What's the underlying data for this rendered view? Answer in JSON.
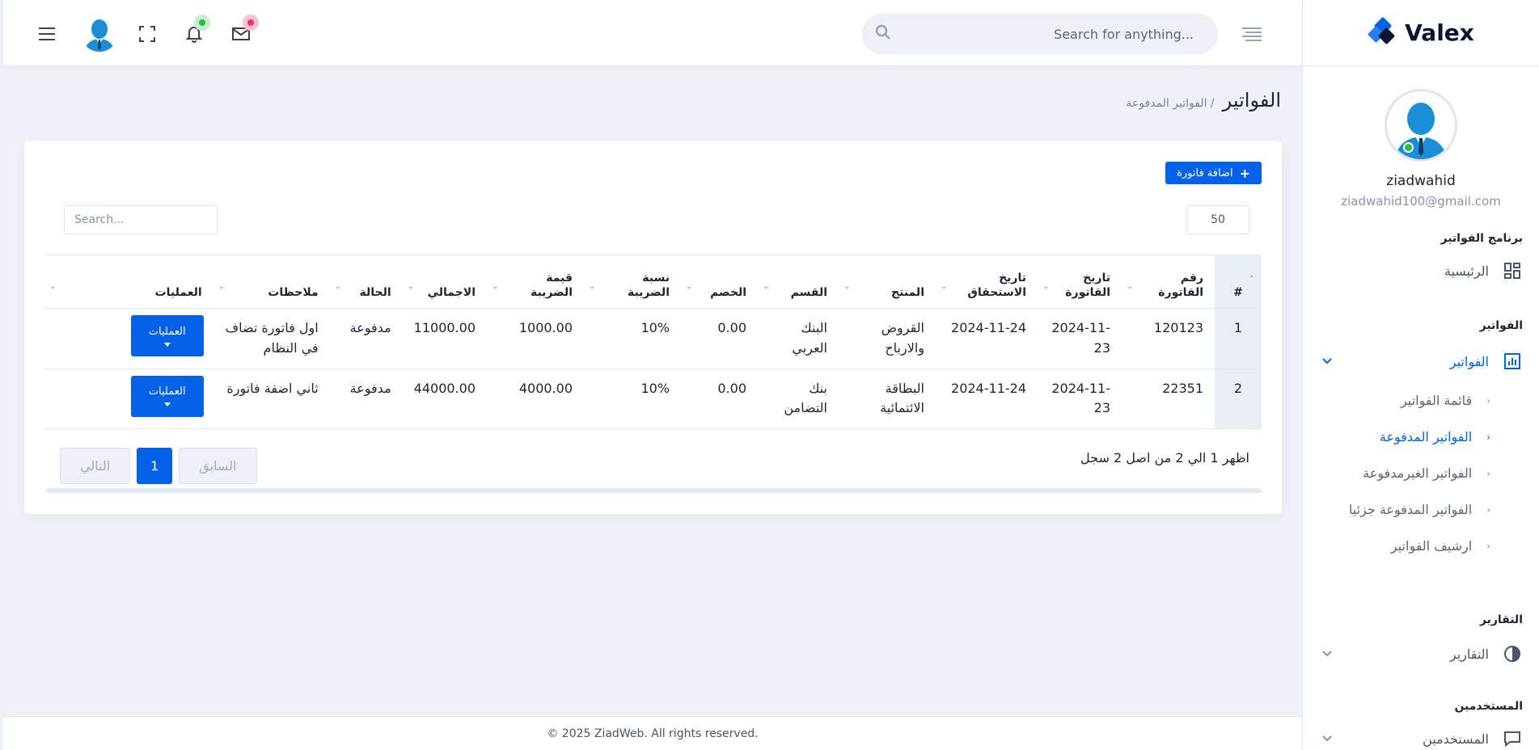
{
  "brand": {
    "name": "Valex",
    "color": "#0162e8"
  },
  "header": {
    "search_placeholder": "Search for anything...",
    "icons": [
      "menu-icon",
      "avatar",
      "fullscreen-icon",
      "bell-icon",
      "mail-icon",
      "search-icon",
      "lines-icon"
    ],
    "notification_badge_color": "#22c03c",
    "mail_badge_color": "#ee335e"
  },
  "sidebar": {
    "user": {
      "name": "ziadwahid",
      "email": "ziadwahid100@gmail.com"
    },
    "sections": [
      {
        "title": "برنامج الفواتير",
        "item": "الرئيسية"
      },
      {
        "title": "الفواتير",
        "item": "الفواتير"
      },
      {
        "title": "التقارير",
        "item": "التقارير"
      },
      {
        "title": "المستخدمين",
        "item": "المستخدمين"
      }
    ],
    "submenu": [
      "قائمة الفواتير",
      "الفواتير المدفوعة",
      "الفواتير الغيرمدفوعة",
      "الفواتير المدفوعة جزئيا",
      "ارشيف الفواتير"
    ],
    "active_submenu": "الفواتير المدفوعة"
  },
  "page": {
    "title": "الفواتير",
    "breadcrumb": "/ الفواتير المدفوعة"
  },
  "card": {
    "add_button": "اضافة فاتورة",
    "length_value": "50",
    "search_placeholder": "Search...",
    "columns": [
      "#",
      "رقم الفاتورة",
      "تاريخ القاتورة",
      "تاريخ الاستحقاق",
      "المنتج",
      "القسم",
      "الخصم",
      "نسبة الضريبة",
      "قيمة الضريبة",
      "الاجمالي",
      "الحالة",
      "ملاحظات",
      "العمليات"
    ],
    "rows": [
      {
        "idx": "1",
        "invoice_no": "120123",
        "invoice_date": "2024-11-23",
        "due_date": "2024-11-24",
        "product": "القروض والارباح",
        "section": "البنك العربي",
        "discount": "0.00",
        "tax_rate": "10%",
        "tax_value": "1000.00",
        "total": "11000.00",
        "status": "مدفوعة",
        "note": "اول فاتورة تضاف في النظام",
        "ops": "العمليات"
      },
      {
        "idx": "2",
        "invoice_no": "22351",
        "invoice_date": "2024-11-23",
        "due_date": "2024-11-24",
        "product": "البطاقة الائتمائية",
        "section": "بنك التضامن",
        "discount": "0.00",
        "tax_rate": "10%",
        "tax_value": "4000.00",
        "total": "44000.00",
        "status": "مدفوعة",
        "note": "ثاني اضفة فاتورة",
        "ops": "العمليات"
      }
    ],
    "info": "اظهر 1 الي 2 من اصل 2 سجل",
    "pagination": {
      "prev": "السابق",
      "current": "1",
      "next": "التالي"
    }
  },
  "footer": {
    "text": "© 2025 ZiadWeb. All rights reserved."
  }
}
